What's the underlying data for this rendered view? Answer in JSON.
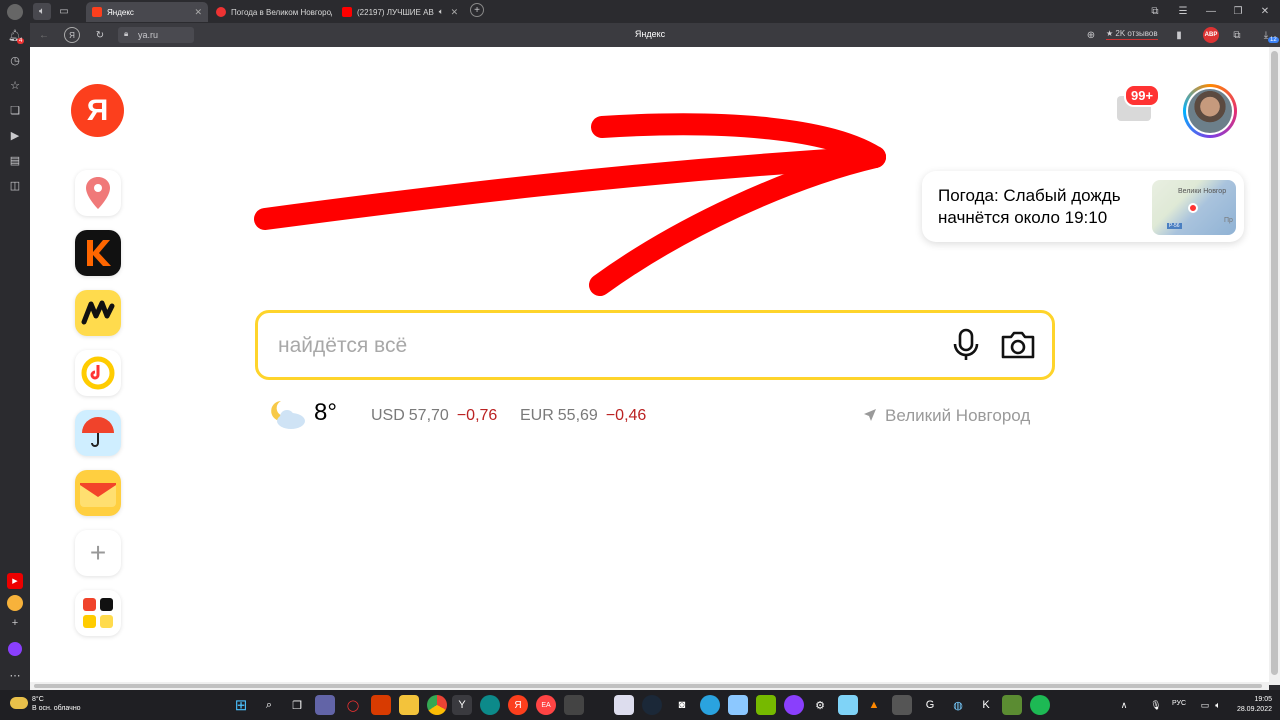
{
  "browser": {
    "tabs": [
      {
        "label": "Яндекс",
        "active": true
      },
      {
        "label": "Погода в Великом Новгород",
        "active": false
      },
      {
        "label": "(22197) ЛУЧШИЕ АВ",
        "active": false
      }
    ],
    "url": "ya.ru",
    "page_title": "Яндекс",
    "reviews_badge": "2K отзывов",
    "left_badge_count": "4",
    "downloads_count": "12"
  },
  "header": {
    "logo": "Я",
    "mail_badge": "99+"
  },
  "weather_card": {
    "text": "Погода: Слабый дождь начнётся около 19:10",
    "map_city": "Велики Новгор",
    "map_road": "Р-56",
    "map_label_right": "Пр"
  },
  "search": {
    "placeholder": "найдётся всё"
  },
  "info": {
    "temperature": "8°",
    "rates": [
      {
        "currency": "USD",
        "value": "57,70",
        "change": "−0,76"
      },
      {
        "currency": "EUR",
        "value": "55,69",
        "change": "−0,46"
      }
    ],
    "city": "Великий Новгород"
  },
  "services": [
    {
      "name": "maps",
      "color": "#ffffff"
    },
    {
      "name": "kinopoisk",
      "color": "#111111"
    },
    {
      "name": "market",
      "color": "#ffdb4d"
    },
    {
      "name": "music",
      "color": "#ffffff"
    },
    {
      "name": "weather",
      "color": "#cfeeff"
    },
    {
      "name": "mail",
      "color": "#ffcf40"
    },
    {
      "name": "add",
      "color": "#ffffff"
    },
    {
      "name": "all-services",
      "color": "#ffffff"
    }
  ],
  "taskbar": {
    "weather_temp": "8°C",
    "weather_desc": "В осн. облачно",
    "lang": "РУС",
    "time": "19:05",
    "date": "28.09.2022"
  }
}
